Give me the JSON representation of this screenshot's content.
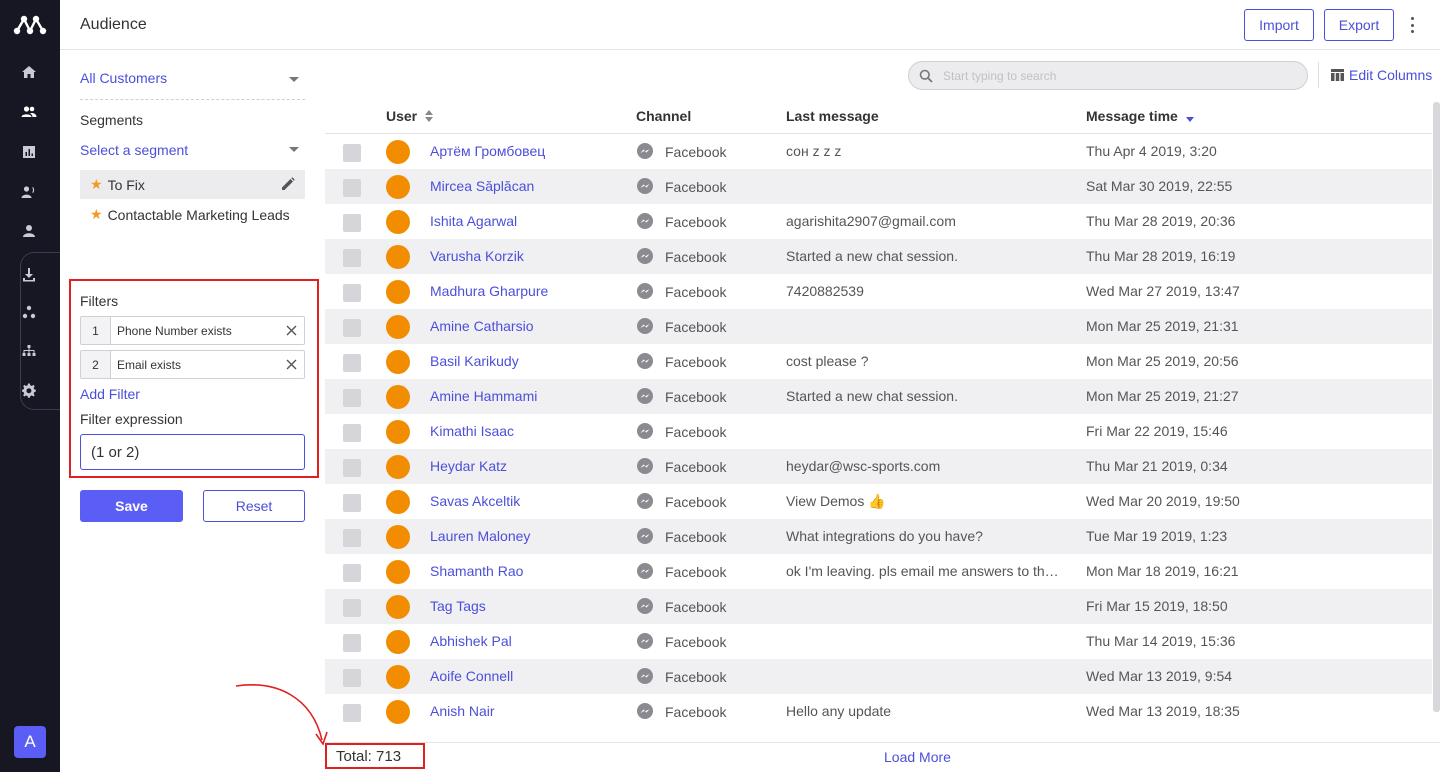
{
  "header": {
    "title": "Audience",
    "import_label": "Import",
    "export_label": "Export"
  },
  "rail": {
    "avatar_letter": "A",
    "icons": [
      "home-icon",
      "people-icon",
      "chart-icon",
      "megaphone-icon",
      "person-icon",
      "download-icon",
      "share-nodes-icon",
      "sitemap-icon",
      "gear-icon"
    ]
  },
  "sidebar": {
    "customer_select": "All Customers",
    "segments_label": "Segments",
    "segment_select": "Select a segment",
    "segments": [
      {
        "label": "To Fix",
        "active": true
      },
      {
        "label": "Contactable Marketing Leads",
        "active": false
      }
    ],
    "filters_label": "Filters",
    "filters": [
      {
        "num": "1",
        "text": "Phone Number exists"
      },
      {
        "num": "2",
        "text": "Email exists"
      }
    ],
    "add_filter": "Add Filter",
    "expression_label": "Filter expression",
    "expression_value": "(1 or 2)",
    "save_label": "Save",
    "reset_label": "Reset"
  },
  "toolbar": {
    "search_placeholder": "Start typing to search",
    "edit_columns": "Edit Columns"
  },
  "table": {
    "columns": {
      "user": "User",
      "channel": "Channel",
      "last_message": "Last message",
      "message_time": "Message time"
    },
    "rows": [
      {
        "user": "Артём Громбовец",
        "channel": "Facebook",
        "message": "сон z z z",
        "time": "Thu Apr 4 2019, 3:20"
      },
      {
        "user": "Mircea Săplăcan",
        "channel": "Facebook",
        "message": "",
        "time": "Sat Mar 30 2019, 22:55"
      },
      {
        "user": "Ishita Agarwal",
        "channel": "Facebook",
        "message": "agarishita2907@gmail.com",
        "time": "Thu Mar 28 2019, 20:36"
      },
      {
        "user": "Varusha Korzik",
        "channel": "Facebook",
        "message": "Started a new chat session.",
        "time": "Thu Mar 28 2019, 16:19"
      },
      {
        "user": "Madhura Gharpure",
        "channel": "Facebook",
        "message": "7420882539",
        "time": "Wed Mar 27 2019, 13:47"
      },
      {
        "user": "Amine Catharsio",
        "channel": "Facebook",
        "message": "",
        "time": "Mon Mar 25 2019, 21:31"
      },
      {
        "user": "Basil Karikudy",
        "channel": "Facebook",
        "message": "cost please ?",
        "time": "Mon Mar 25 2019, 20:56"
      },
      {
        "user": "Amine Hammami",
        "channel": "Facebook",
        "message": "Started a new chat session.",
        "time": "Mon Mar 25 2019, 21:27"
      },
      {
        "user": "Kimathi Isaac",
        "channel": "Facebook",
        "message": "",
        "time": "Fri Mar 22 2019, 15:46"
      },
      {
        "user": "Heydar Katz",
        "channel": "Facebook",
        "message": "heydar@wsc-sports.com",
        "time": "Thu Mar 21 2019, 0:34"
      },
      {
        "user": "Savas Akceltik",
        "channel": "Facebook",
        "message": "View Demos 👍",
        "time": "Wed Mar 20 2019, 19:50"
      },
      {
        "user": "Lauren Maloney",
        "channel": "Facebook",
        "message": "What integrations do you have?",
        "time": "Tue Mar 19 2019, 1:23"
      },
      {
        "user": "Shamanth Rao",
        "channel": "Facebook",
        "message": "ok I'm leaving. pls email me answers to the q...",
        "time": "Mon Mar 18 2019, 16:21"
      },
      {
        "user": "Tag Tags",
        "channel": "Facebook",
        "message": "",
        "time": "Fri Mar 15 2019, 18:50"
      },
      {
        "user": "Abhishek Pal",
        "channel": "Facebook",
        "message": "",
        "time": "Thu Mar 14 2019, 15:36"
      },
      {
        "user": "Aoife Connell",
        "channel": "Facebook",
        "message": "",
        "time": "Wed Mar 13 2019, 9:54"
      },
      {
        "user": "Anish Nair",
        "channel": "Facebook",
        "message": "Hello any update",
        "time": "Wed Mar 13 2019, 18:35"
      }
    ]
  },
  "footer": {
    "total": "Total: 713",
    "load_more": "Load More"
  },
  "colors": {
    "accent": "#4b4fd9",
    "button_primary": "#5b5ef5",
    "avatar_orange": "#f28c00",
    "annotation_red": "#e02020",
    "rail_bg": "#161722"
  }
}
